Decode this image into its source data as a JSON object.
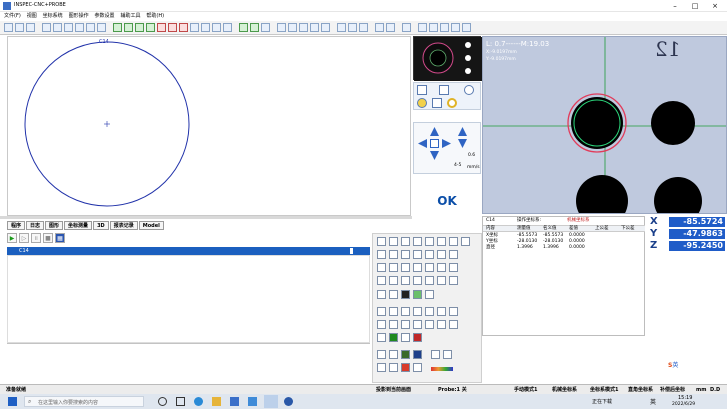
{
  "window": {
    "title": "INSPEC-CNC+PROBE",
    "minimize": "–",
    "maximize": "□",
    "close": "×"
  },
  "menu": [
    "文件(F)",
    "视图",
    "坐标系统",
    "图形操作",
    "参数设置",
    "辅助工具",
    "帮助(H)"
  ],
  "canvas": {
    "circle_label": "C14"
  },
  "tabs": [
    "程序",
    "日志",
    "图形",
    "坐标测量",
    "3D",
    "报表记录",
    "Model"
  ],
  "program": {
    "current_item": "C14"
  },
  "camera": {
    "info_line1": "L: 0.7------M:19.03",
    "info_line2": "X:-9.0197mm",
    "info_line3": "Y:-9.0197mm",
    "overlay_number": "12"
  },
  "dpad": {
    "speed_label": "0.6",
    "step_label": "4-5",
    "unit_label": "mm/s"
  },
  "ok_button": "OK",
  "table": {
    "element": "C14",
    "headers_top": [
      "操作坐标系:",
      "机械坐标系"
    ],
    "columns": [
      "内容",
      "测量值",
      "名义值",
      "差值",
      "上公差",
      "下公差"
    ],
    "rows": [
      [
        "X坐标",
        "-85.5573",
        "-85.5573",
        "0.0000",
        "",
        ""
      ],
      [
        "Y坐标",
        "-28.0130",
        "-28.0130",
        "0.0000",
        "",
        ""
      ],
      [
        "直径",
        "1.3996",
        "1.3996",
        "0.0000",
        "",
        ""
      ]
    ]
  },
  "coords": {
    "x_label": "X",
    "x_value": "-85.5724",
    "y_label": "Y",
    "y_value": "-47.9863",
    "z_label": "Z",
    "z_value": "-95.2450"
  },
  "statusbar": {
    "left": "准备就绪",
    "mid1": "投影到当前画面",
    "mid2": "Probe:1 关",
    "r1": "手动模式1",
    "r2": "机械坐标系",
    "r3": "坐标系模式1",
    "r4": "直角坐标系",
    "r5": "补偿后坐标",
    "r6": "mm",
    "r7": "D.D"
  },
  "taskbar": {
    "search_placeholder": "在这里输入你要搜索的内容",
    "time": "15:19",
    "date": "2022/6/29",
    "ime": "英",
    "tray_label": "正在下载"
  },
  "colors": {
    "circle": "#2233aa",
    "selection_bar": "#1b5fbf",
    "coord_value_bg": "#1f5cc8",
    "ok_text": "#0b4ea8",
    "measure_circle": "#e23b5a",
    "fit_circle": "#2bd67b"
  },
  "icons": [
    "new-icon",
    "open-icon",
    "save-icon",
    "move-icon",
    "zoom-icon",
    "fit-icon",
    "text-icon",
    "point-icon",
    "line-icon",
    "circle-icon",
    "angle-icon",
    "distance-icon",
    "camera-icon",
    "light-icon",
    "settings-icon"
  ]
}
